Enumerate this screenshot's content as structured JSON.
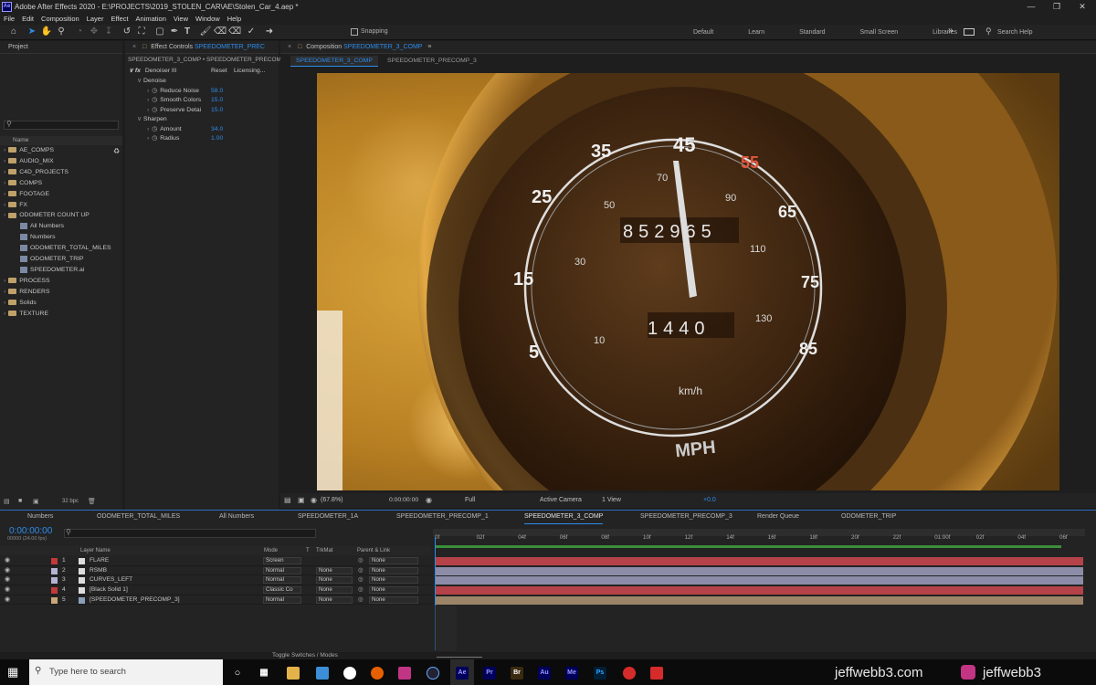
{
  "window": {
    "title": "Adobe After Effects 2020 - E:\\PROJECTS\\2019_STOLEN_CAR\\AE\\Stolen_Car_4.aep *",
    "logo": "Ae"
  },
  "menu": [
    "File",
    "Edit",
    "Composition",
    "Layer",
    "Effect",
    "Animation",
    "View",
    "Window",
    "Help"
  ],
  "toolbar": {
    "snapping": "Snapping"
  },
  "workspaces": [
    "Default",
    "Learn",
    "Standard",
    "Small Screen",
    "Libraries"
  ],
  "search_help": "Search Help",
  "project": {
    "tab": "Project",
    "column": "Name",
    "items": [
      {
        "label": "AE_COMPS",
        "type": "folder",
        "indent": 0
      },
      {
        "label": "AUDIO_MIX",
        "type": "folder",
        "indent": 0
      },
      {
        "label": "C4D_PROJECTS",
        "type": "folder",
        "indent": 0
      },
      {
        "label": "COMPS",
        "type": "folder",
        "indent": 0
      },
      {
        "label": "FOOTAGE",
        "type": "folder",
        "indent": 0
      },
      {
        "label": "FX",
        "type": "folder",
        "indent": 0
      },
      {
        "label": "ODOMETER COUNT UP",
        "type": "folder",
        "indent": 0
      },
      {
        "label": "All Numbers",
        "type": "file",
        "indent": 1
      },
      {
        "label": "Numbers",
        "type": "file",
        "indent": 1
      },
      {
        "label": "ODOMETER_TOTAL_MILES",
        "type": "file",
        "indent": 1
      },
      {
        "label": "ODOMETER_TRIP",
        "type": "file",
        "indent": 1
      },
      {
        "label": "SPEEDOMETER.ai",
        "type": "file",
        "indent": 1
      },
      {
        "label": "PROCESS",
        "type": "folder",
        "indent": 0
      },
      {
        "label": "RENDERS",
        "type": "folder",
        "indent": 0
      },
      {
        "label": "Solids",
        "type": "folder",
        "indent": 0
      },
      {
        "label": "TEXTURE",
        "type": "folder",
        "indent": 0
      }
    ],
    "bpc": "32 bpc"
  },
  "effect_controls": {
    "tab_prefix": "Effect Controls",
    "tab_comp": "SPEEDOMETER_PREC",
    "breadcrumb": "SPEEDOMETER_3_COMP • SPEEDOMETER_PRECOM",
    "effect_name": "Denoiser III",
    "reset": "Reset",
    "licensing": "Licensing...",
    "groups": [
      {
        "name": "Denoise",
        "params": [
          {
            "label": "Reduce Noise",
            "value": "58.0"
          },
          {
            "label": "Smooth Colors",
            "value": "15.0"
          },
          {
            "label": "Preserve Detai",
            "value": "15.0"
          }
        ]
      },
      {
        "name": "Sharpen",
        "params": [
          {
            "label": "Amount",
            "value": "34.0"
          },
          {
            "label": "Radius",
            "value": "1.00"
          }
        ]
      }
    ]
  },
  "composition": {
    "tab_prefix": "Composition",
    "tab_comp": "SPEEDOMETER_3_COMP",
    "subtabs": [
      "SPEEDOMETER_3_COMP",
      "SPEEDOMETER_PRECOMP_3"
    ],
    "zoom": "(67.8%)",
    "timecode": "0:00:00:00",
    "resolution": "Full",
    "camera": "Active Camera",
    "views": "1 View",
    "exposure": "+0.0"
  },
  "speedometer": {
    "outer_numbers": [
      "35",
      "45",
      "55",
      "25",
      "65",
      "15",
      "75",
      "5",
      "85"
    ],
    "inner_numbers": [
      "70",
      "50",
      "90",
      "30",
      "110",
      "10",
      "130"
    ],
    "odometer_top": "852965",
    "odometer_bottom": "1440",
    "unit_kmh": "km/h",
    "unit_mph": "MPH",
    "needle_value_mph": 45
  },
  "timeline": {
    "tabs": [
      "Numbers",
      "ODOMETER_TOTAL_MILES",
      "All Numbers",
      "SPEEDOMETER_1A",
      "SPEEDOMETER_PRECOMP_1",
      "SPEEDOMETER_3_COMP",
      "SPEEDOMETER_PRECOMP_3",
      "Render Queue",
      "ODOMETER_TRIP"
    ],
    "active_tab": "SPEEDOMETER_3_COMP",
    "timecode": "0:00:00:00",
    "fps": "00000 (24.00 fps)",
    "columns": {
      "layer_name": "Layer Name",
      "mode": "Mode",
      "t": "T",
      "trkmat": "TrkMat",
      "parent": "Parent & Link"
    },
    "ruler": [
      "0f",
      "02f",
      "04f",
      "06f",
      "08f",
      "10f",
      "12f",
      "14f",
      "16f",
      "18f",
      "20f",
      "22f",
      "01:00f",
      "02f",
      "04f",
      "06f"
    ],
    "layers": [
      {
        "num": "1",
        "name": "FLARE",
        "mode": "Screen",
        "trkmat": "",
        "parent": "None",
        "color": "#c0393b",
        "bar": "#b54248"
      },
      {
        "num": "2",
        "name": "RSMB",
        "mode": "Normal",
        "trkmat": "None",
        "parent": "None",
        "color": "#b3b3d6",
        "bar": "#8c8ca8"
      },
      {
        "num": "3",
        "name": "CURVES_LEFT",
        "mode": "Normal",
        "trkmat": "None",
        "parent": "None",
        "color": "#b3b3d6",
        "bar": "#8c8ca8"
      },
      {
        "num": "4",
        "name": "[Black Solid 1]",
        "mode": "Classic Co",
        "trkmat": "None",
        "parent": "None",
        "color": "#c0393b",
        "bar": "#b54248"
      },
      {
        "num": "5",
        "name": "[SPEEDOMETER_PRECOMP_3]",
        "mode": "Normal",
        "trkmat": "None",
        "parent": "None",
        "color": "#c8a878",
        "bar": "#9c8468"
      }
    ],
    "toggle": "Toggle Switches / Modes"
  },
  "taskbar": {
    "search": "Type here to search"
  },
  "watermark": {
    "site": "jeffwebb3.com",
    "instagram": "jeffwebb3"
  }
}
